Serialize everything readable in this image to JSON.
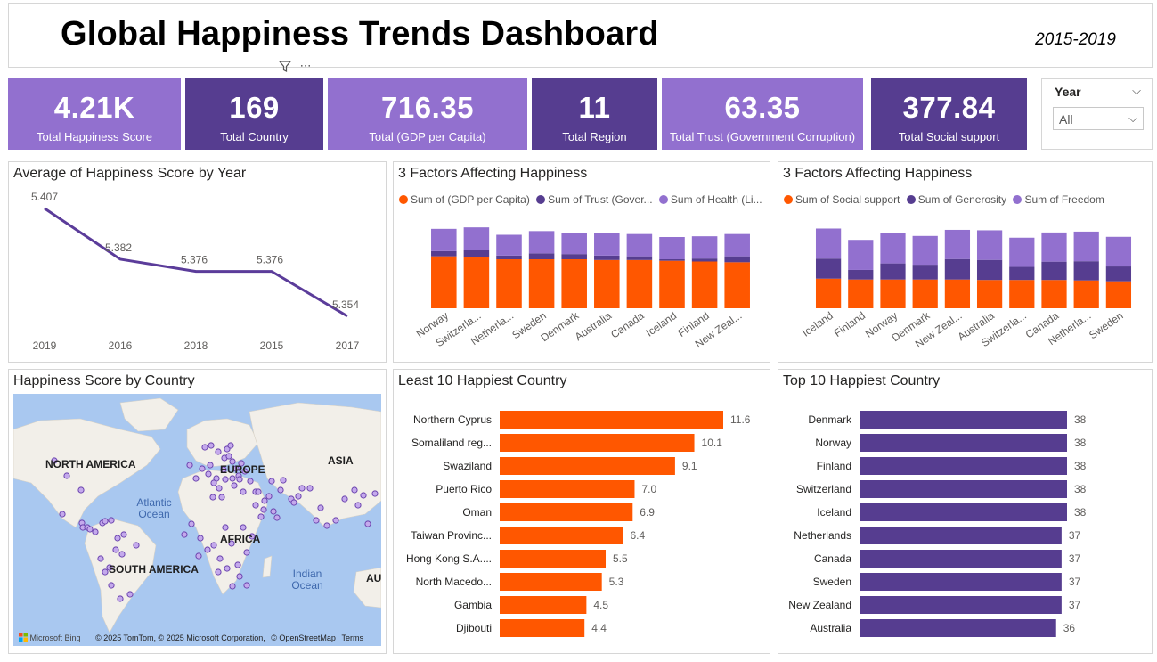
{
  "header": {
    "title": "Global Happiness Trends Dashboard",
    "period": "2015-2019",
    "filter_icon": "filter-icon",
    "more_icon": "more-options-icon"
  },
  "kpis": [
    {
      "value": "4.21K",
      "label": "Total Happiness Score",
      "color": "#9270cf"
    },
    {
      "value": "169",
      "label": "Total Country",
      "color": "#563d90"
    },
    {
      "value": "716.35",
      "label": "Total (GDP per Capita)",
      "color": "#9270cf"
    },
    {
      "value": "11",
      "label": "Total Region",
      "color": "#563d90"
    },
    {
      "value": "63.35",
      "label": "Total Trust (Government Corruption)",
      "color": "#9270cf"
    },
    {
      "value": "377.84",
      "label": "Total Social support",
      "color": "#563d90"
    }
  ],
  "slicer": {
    "label": "Year",
    "selected": "All",
    "icon": "chevron-down-icon"
  },
  "colors": {
    "orange": "#ff5700",
    "dark_purple": "#563d90",
    "light_purple": "#9270cf",
    "line": "#5b3c9a",
    "map_water": "#a9c8f0",
    "map_land": "#f2efe9"
  },
  "chart_data": [
    {
      "id": "avg-score-by-year",
      "type": "line",
      "title": "Average of Happiness Score by Year",
      "categories": [
        "2019",
        "2016",
        "2018",
        "2015",
        "2017"
      ],
      "values": [
        5.407,
        5.382,
        5.376,
        5.376,
        5.354
      ],
      "value_labels": [
        "5.407",
        "5.382",
        "5.376",
        "5.376",
        "5.354"
      ],
      "xlabel": "",
      "ylabel": "",
      "grid": false
    },
    {
      "id": "factors-1",
      "type": "bar",
      "stacked": true,
      "title": "3 Factors Affecting Happiness",
      "legend_position": "top-left",
      "categories": [
        "Norway",
        "Switzerla...",
        "Netherla...",
        "Sweden",
        "Denmark",
        "Australia",
        "Canada",
        "Iceland",
        "Finland",
        "New Zeal..."
      ],
      "series": [
        {
          "name": "Sum of (GDP per Capita)",
          "color": "#ff5700",
          "values": [
            7.0,
            6.9,
            6.6,
            6.6,
            6.6,
            6.5,
            6.5,
            6.4,
            6.3,
            6.2
          ]
        },
        {
          "name": "Sum of Trust (Gover...",
          "color": "#563d90",
          "values": [
            0.7,
            0.9,
            0.5,
            0.8,
            0.7,
            0.6,
            0.5,
            0.2,
            0.4,
            0.8
          ]
        },
        {
          "name": "Sum of Health (Li...",
          "color": "#9270cf",
          "values": [
            3.0,
            3.1,
            2.8,
            3.0,
            2.9,
            3.1,
            3.0,
            3.0,
            3.0,
            3.0
          ]
        }
      ]
    },
    {
      "id": "factors-2",
      "type": "bar",
      "stacked": true,
      "title": "3 Factors Affecting Happiness",
      "legend_position": "top-left",
      "categories": [
        "Iceland",
        "Finland",
        "Norway",
        "Denmark",
        "New Zeal...",
        "Australia",
        "Switzerla...",
        "Canada",
        "Netherla...",
        "Sweden"
      ],
      "series": [
        {
          "name": "Sum of Social support",
          "color": "#ff5700",
          "values": [
            6.8,
            6.6,
            6.6,
            6.6,
            6.6,
            6.5,
            6.5,
            6.5,
            6.4,
            6.2
          ]
        },
        {
          "name": "Sum of Generosity",
          "color": "#563d90",
          "values": [
            4.6,
            2.2,
            3.7,
            3.4,
            4.7,
            4.6,
            3.0,
            4.2,
            4.4,
            3.4
          ]
        },
        {
          "name": "Sum of Freedom",
          "color": "#9270cf",
          "values": [
            6.9,
            6.9,
            7.0,
            6.6,
            6.7,
            6.8,
            6.7,
            6.7,
            6.8,
            6.8
          ]
        }
      ]
    },
    {
      "id": "least-10",
      "type": "bar",
      "orientation": "horizontal",
      "title": "Least 10 Happiest Country",
      "color": "#ff5700",
      "categories": [
        "Northern Cyprus",
        "Somaliland reg...",
        "Swaziland",
        "Puerto Rico",
        "Oman",
        "Taiwan Provinc...",
        "Hong Kong S.A....",
        "North Macedo...",
        "Gambia",
        "Djibouti"
      ],
      "values": [
        11.6,
        10.1,
        9.1,
        7.0,
        6.9,
        6.4,
        5.5,
        5.3,
        4.5,
        4.4
      ],
      "value_labels": [
        "11.6",
        "10.1",
        "9.1",
        "7.0",
        "6.9",
        "6.4",
        "5.5",
        "5.3",
        "4.5",
        "4.4"
      ]
    },
    {
      "id": "top-10",
      "type": "bar",
      "orientation": "horizontal",
      "title": "Top 10 Happiest Country",
      "color": "#563d90",
      "categories": [
        "Denmark",
        "Norway",
        "Finland",
        "Switzerland",
        "Iceland",
        "Netherlands",
        "Canada",
        "Sweden",
        "New Zealand",
        "Australia"
      ],
      "values": [
        38,
        38,
        38,
        38,
        38,
        37,
        37,
        37,
        37,
        36
      ],
      "value_labels": [
        "38",
        "38",
        "38",
        "38",
        "38",
        "37",
        "37",
        "37",
        "37",
        "36"
      ]
    }
  ],
  "map": {
    "title": "Happiness Score by Country",
    "continent_labels": [
      "NORTH AMERICA",
      "EUROPE",
      "ASIA",
      "AFRICA",
      "SOUTH AMERICA",
      "AU"
    ],
    "ocean_labels": [
      "Atlantic Ocean",
      "Indian Ocean"
    ],
    "attribution_brand": "Microsoft Bing",
    "attribution": "© 2025 TomTom, © 2025 Microsoft Corporation,",
    "osm_link": "© OpenStreetMap",
    "terms_link": "Terms"
  }
}
